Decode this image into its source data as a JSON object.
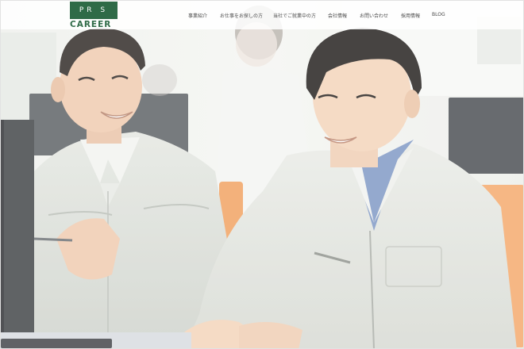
{
  "brand": {
    "logo_top": "PR  S",
    "logo_bottom": "CAREER",
    "primary_color": "#2f6b47"
  },
  "nav": {
    "items": [
      {
        "label": "事業紹介"
      },
      {
        "label": "お仕事をお探しの方"
      },
      {
        "label": "当社でご就業中の方"
      },
      {
        "label": "会社情報"
      },
      {
        "label": "お問い合わせ"
      },
      {
        "label": "採用情報"
      },
      {
        "label": "BLOG"
      }
    ]
  },
  "hero": {
    "subject": "two-workers-smiling-photo"
  }
}
